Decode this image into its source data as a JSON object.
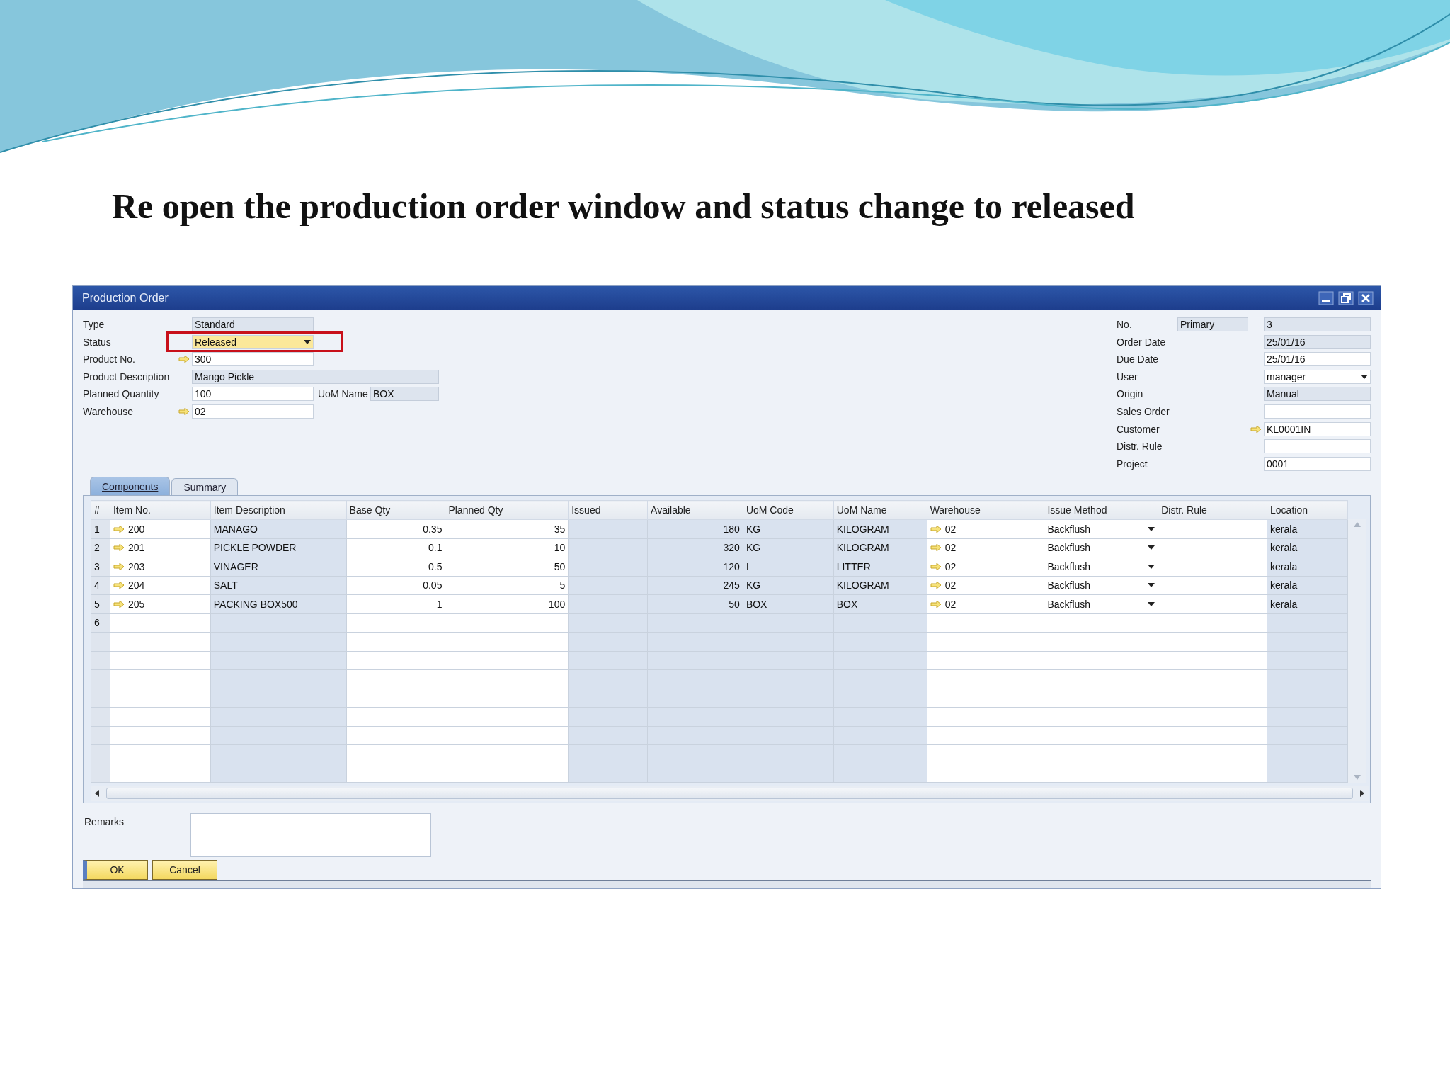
{
  "slide": {
    "title": "Re open the production order window and status change to released"
  },
  "window": {
    "title": "Production Order"
  },
  "header_left": [
    {
      "label": "Type",
      "value": "Standard",
      "kind": "readonly",
      "focused": false,
      "highlighted": false
    },
    {
      "label": "Status",
      "value": "Released",
      "kind": "dropdown",
      "focused": true,
      "highlighted": true
    },
    {
      "label": "Product No.",
      "value": "300",
      "kind": "link",
      "focused": false,
      "highlighted": false
    },
    {
      "label": "Product Description",
      "value": "Mango Pickle",
      "kind": "readonly-wide",
      "focused": false,
      "highlighted": false
    },
    {
      "label": "Planned Quantity",
      "value": "100",
      "kind": "input",
      "focused": false,
      "highlighted": false,
      "extra": {
        "label": "UoM Name",
        "value": "BOX"
      }
    },
    {
      "label": "Warehouse",
      "value": "02",
      "kind": "link",
      "focused": false,
      "highlighted": false
    }
  ],
  "header_right": [
    {
      "label": "No.",
      "series": "Primary",
      "value": "3",
      "kind": "readonly"
    },
    {
      "label": "Order Date",
      "value": "25/01/16",
      "kind": "readonly"
    },
    {
      "label": "Due Date",
      "value": "25/01/16",
      "kind": "input"
    },
    {
      "label": "User",
      "value": "manager",
      "kind": "dropdown"
    },
    {
      "label": "Origin",
      "value": "Manual",
      "kind": "readonly"
    },
    {
      "label": "Sales Order",
      "kind": "input"
    },
    {
      "label": "Customer",
      "value": "KL0001IN",
      "kind": "link"
    },
    {
      "label": "Distr. Rule",
      "kind": "input"
    },
    {
      "label": "Project",
      "value": "0001",
      "kind": "input"
    }
  ],
  "tabs": [
    {
      "label": "Components",
      "selected": true
    },
    {
      "label": "Summary",
      "selected": false
    }
  ],
  "table": {
    "columns": [
      {
        "label": "#",
        "kind": "index",
        "editable": false
      },
      {
        "label": "Item No.",
        "kind": "link",
        "editable": true
      },
      {
        "label": "Item Description",
        "kind": "text",
        "editable": false
      },
      {
        "label": "Base Qty",
        "kind": "number",
        "editable": true
      },
      {
        "label": "Planned Qty",
        "kind": "number",
        "editable": true
      },
      {
        "label": "Issued",
        "kind": "number",
        "editable": false
      },
      {
        "label": "Available",
        "kind": "number",
        "editable": false
      },
      {
        "label": "UoM Code",
        "kind": "text",
        "editable": false
      },
      {
        "label": "UoM Name",
        "kind": "text",
        "editable": false
      },
      {
        "label": "Warehouse",
        "kind": "link",
        "editable": true
      },
      {
        "label": "Issue Method",
        "kind": "dropdown",
        "editable": true
      },
      {
        "label": "Distr. Rule",
        "kind": "text",
        "editable": true
      },
      {
        "label": "Location",
        "kind": "text",
        "editable": false
      }
    ],
    "rows": [
      [
        "1",
        "200",
        "MANAGO",
        "0.35",
        "35",
        null,
        "180",
        "KG",
        "KILOGRAM",
        "02",
        "Backflush",
        null,
        "kerala"
      ],
      [
        "2",
        "201",
        "PICKLE POWDER",
        "0.1",
        "10",
        null,
        "320",
        "KG",
        "KILOGRAM",
        "02",
        "Backflush",
        null,
        "kerala"
      ],
      [
        "3",
        "203",
        "VINAGER",
        "0.5",
        "50",
        null,
        "120",
        "L",
        "LITTER",
        "02",
        "Backflush",
        null,
        "kerala"
      ],
      [
        "4",
        "204",
        "SALT",
        "0.05",
        "5",
        null,
        "245",
        "KG",
        "KILOGRAM",
        "02",
        "Backflush",
        null,
        "kerala"
      ],
      [
        "5",
        "205",
        "PACKING BOX500",
        "1",
        "100",
        null,
        "50",
        "BOX",
        "BOX",
        "02",
        "Backflush",
        null,
        "kerala"
      ],
      [
        "6"
      ]
    ]
  },
  "remarks": {
    "label": "Remarks"
  },
  "buttons": [
    {
      "label": "OK",
      "default": true
    },
    {
      "label": "Cancel",
      "default": false
    }
  ]
}
